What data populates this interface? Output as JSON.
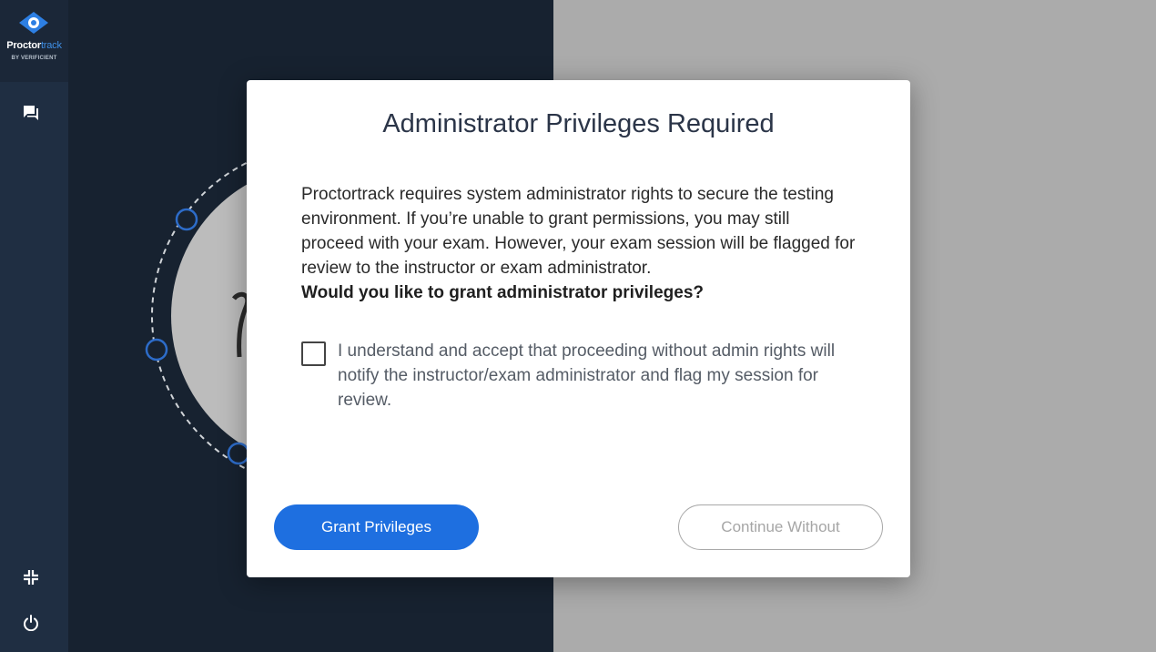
{
  "brand": {
    "name_part1": "Proctor",
    "name_part2": "track",
    "subtitle": "BY VERIFICIENT",
    "accent_color": "#3f8fe6"
  },
  "sidebar": {
    "icons": [
      "chat-icon",
      "collapse-icon",
      "power-icon"
    ]
  },
  "modal": {
    "title": "Administrator Privileges Required",
    "body": "Proctortrack requires system administrator rights to secure the testing environment. If you’re unable to grant permissions, you may still proceed with your exam. However, your exam session will be flagged for review to the instructor or exam administrator.",
    "question": "Would you like to grant administrator privileges?",
    "consent": "I understand and accept that proceeding without admin rights will notify the instructor/exam administrator and flag my session for review.",
    "consent_checked": false,
    "grant_label": "Grant Privileges",
    "continue_label": "Continue Without",
    "primary_color": "#1e6fe0"
  }
}
